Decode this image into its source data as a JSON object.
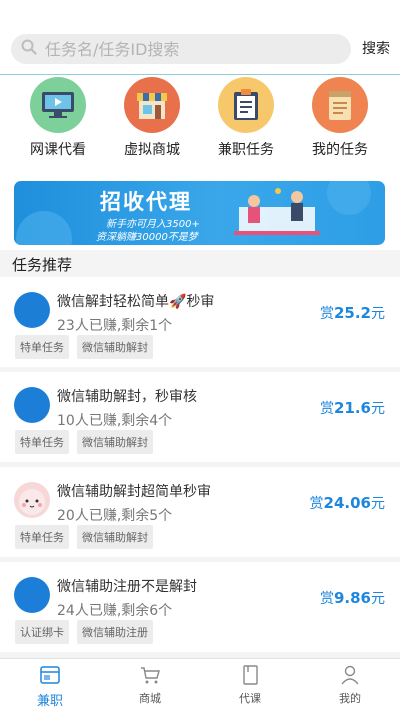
{
  "search": {
    "placeholder": "任务名/任务ID搜索",
    "button_label": "搜索"
  },
  "categories": [
    {
      "label": "网课代看",
      "icon": "monitor-icon",
      "color": "#7ed09a"
    },
    {
      "label": "虚拟商城",
      "icon": "store-icon",
      "color": "#e8714b"
    },
    {
      "label": "兼职任务",
      "icon": "clipboard-icon",
      "color": "#f6c86b"
    },
    {
      "label": "我的任务",
      "icon": "notepad-icon",
      "color": "#ef8451"
    }
  ],
  "banner": {
    "title": "招收代理",
    "line1": "新手亦可月入3500+",
    "line2": "资深躺赚30000不是梦"
  },
  "section_title": "任务推荐",
  "tasks": [
    {
      "title": "微信解封轻松简单🚀秒审",
      "meta": "23人已赚,剩余1个",
      "reward_prefix": "赏",
      "reward_value": "25.2",
      "reward_unit": "元",
      "tags": [
        "特单任务",
        "微信辅助解封"
      ]
    },
    {
      "title": "微信辅助解封，秒审核",
      "meta": "10人已赚,剩余4个",
      "reward_prefix": "赏",
      "reward_value": "21.6",
      "reward_unit": "元",
      "tags": [
        "特单任务",
        "微信辅助解封"
      ]
    },
    {
      "title": "微信辅助解封超简单秒审",
      "meta": "20人已赚,剩余5个",
      "reward_prefix": "赏",
      "reward_value": "24.06",
      "reward_unit": "元",
      "tags": [
        "特单任务",
        "微信辅助解封"
      ]
    },
    {
      "title": "微信辅助注册不是解封",
      "meta": "24人已赚,剩余6个",
      "reward_prefix": "赏",
      "reward_value": "9.86",
      "reward_unit": "元",
      "tags": [
        "认证绑卡",
        "微信辅助注册"
      ]
    }
  ],
  "nav": [
    {
      "label": "兼职",
      "icon": "card-icon",
      "active": true
    },
    {
      "label": "商城",
      "icon": "cart-icon",
      "active": false
    },
    {
      "label": "代课",
      "icon": "book-icon",
      "active": false
    },
    {
      "label": "我的",
      "icon": "user-icon",
      "active": false
    }
  ],
  "colors": {
    "accent": "#1f86dd",
    "avatar_blue": "#1d7ed8"
  }
}
